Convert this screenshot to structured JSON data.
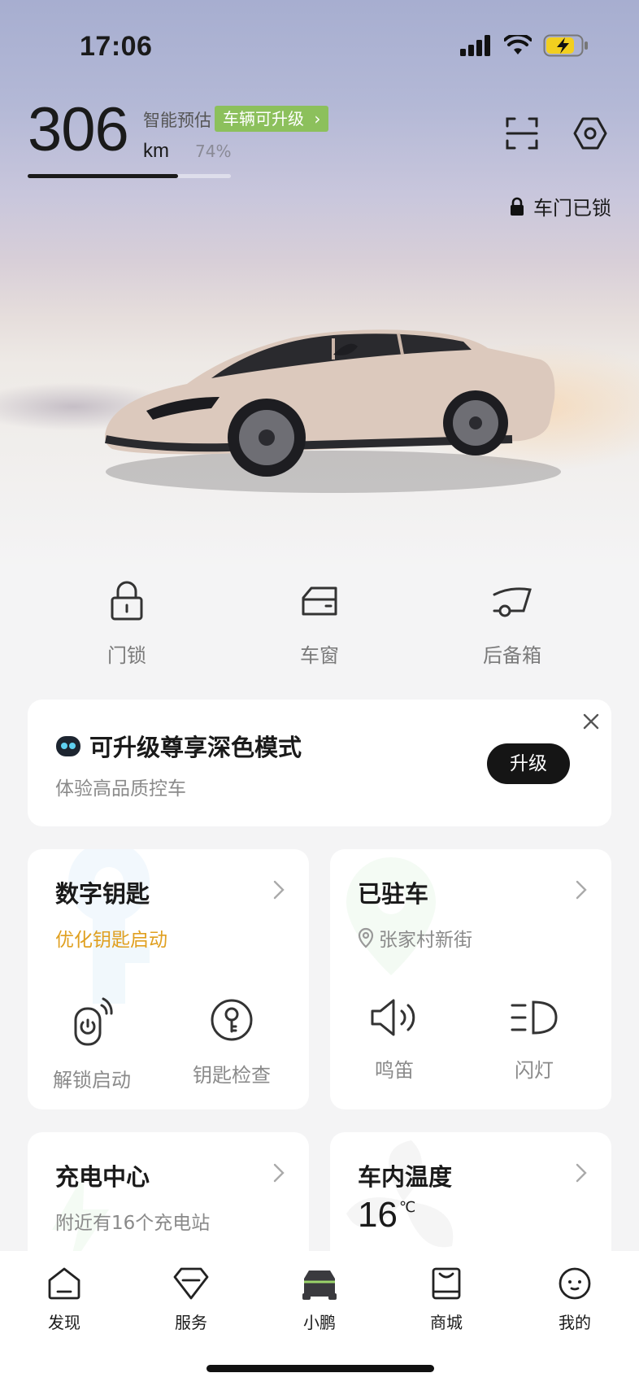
{
  "status_bar": {
    "time": "17:06"
  },
  "header": {
    "range_value": "306",
    "range_unit": "km",
    "range_label": "智能预估",
    "upgrade_tag": "车辆可升级",
    "battery_percent": "74%",
    "battery_fraction": 0.74,
    "lock_status": "车门已锁"
  },
  "quick_actions": [
    {
      "label": "门锁",
      "icon": "padlock-icon"
    },
    {
      "label": "车窗",
      "icon": "car-window-icon"
    },
    {
      "label": "后备箱",
      "icon": "trunk-icon"
    }
  ],
  "promo": {
    "title": "可升级尊享深色模式",
    "subtitle": "体验高品质控车",
    "button": "升级"
  },
  "cards": {
    "digital_key": {
      "title": "数字钥匙",
      "subtitle": "优化钥匙启动",
      "subtitle_color": "#e0a020",
      "actions": [
        "解锁启动",
        "钥匙检查"
      ]
    },
    "parked": {
      "title": "已驻车",
      "location": "张家村新街",
      "actions": [
        "鸣笛",
        "闪灯"
      ]
    },
    "charging": {
      "title": "充电中心",
      "subtitle": "附近有16个充电站"
    },
    "temperature": {
      "title": "车内温度",
      "value": "16",
      "unit": "℃"
    }
  },
  "tabbar": [
    {
      "label": "发现",
      "icon": "discover-icon"
    },
    {
      "label": "服务",
      "icon": "service-icon"
    },
    {
      "label": "小鹏",
      "icon": "car-icon",
      "active": true
    },
    {
      "label": "商城",
      "icon": "shop-icon"
    },
    {
      "label": "我的",
      "icon": "profile-icon"
    }
  ],
  "colors": {
    "upgrade_tag": "#8cc05c",
    "accent_text": "#e0a020"
  }
}
